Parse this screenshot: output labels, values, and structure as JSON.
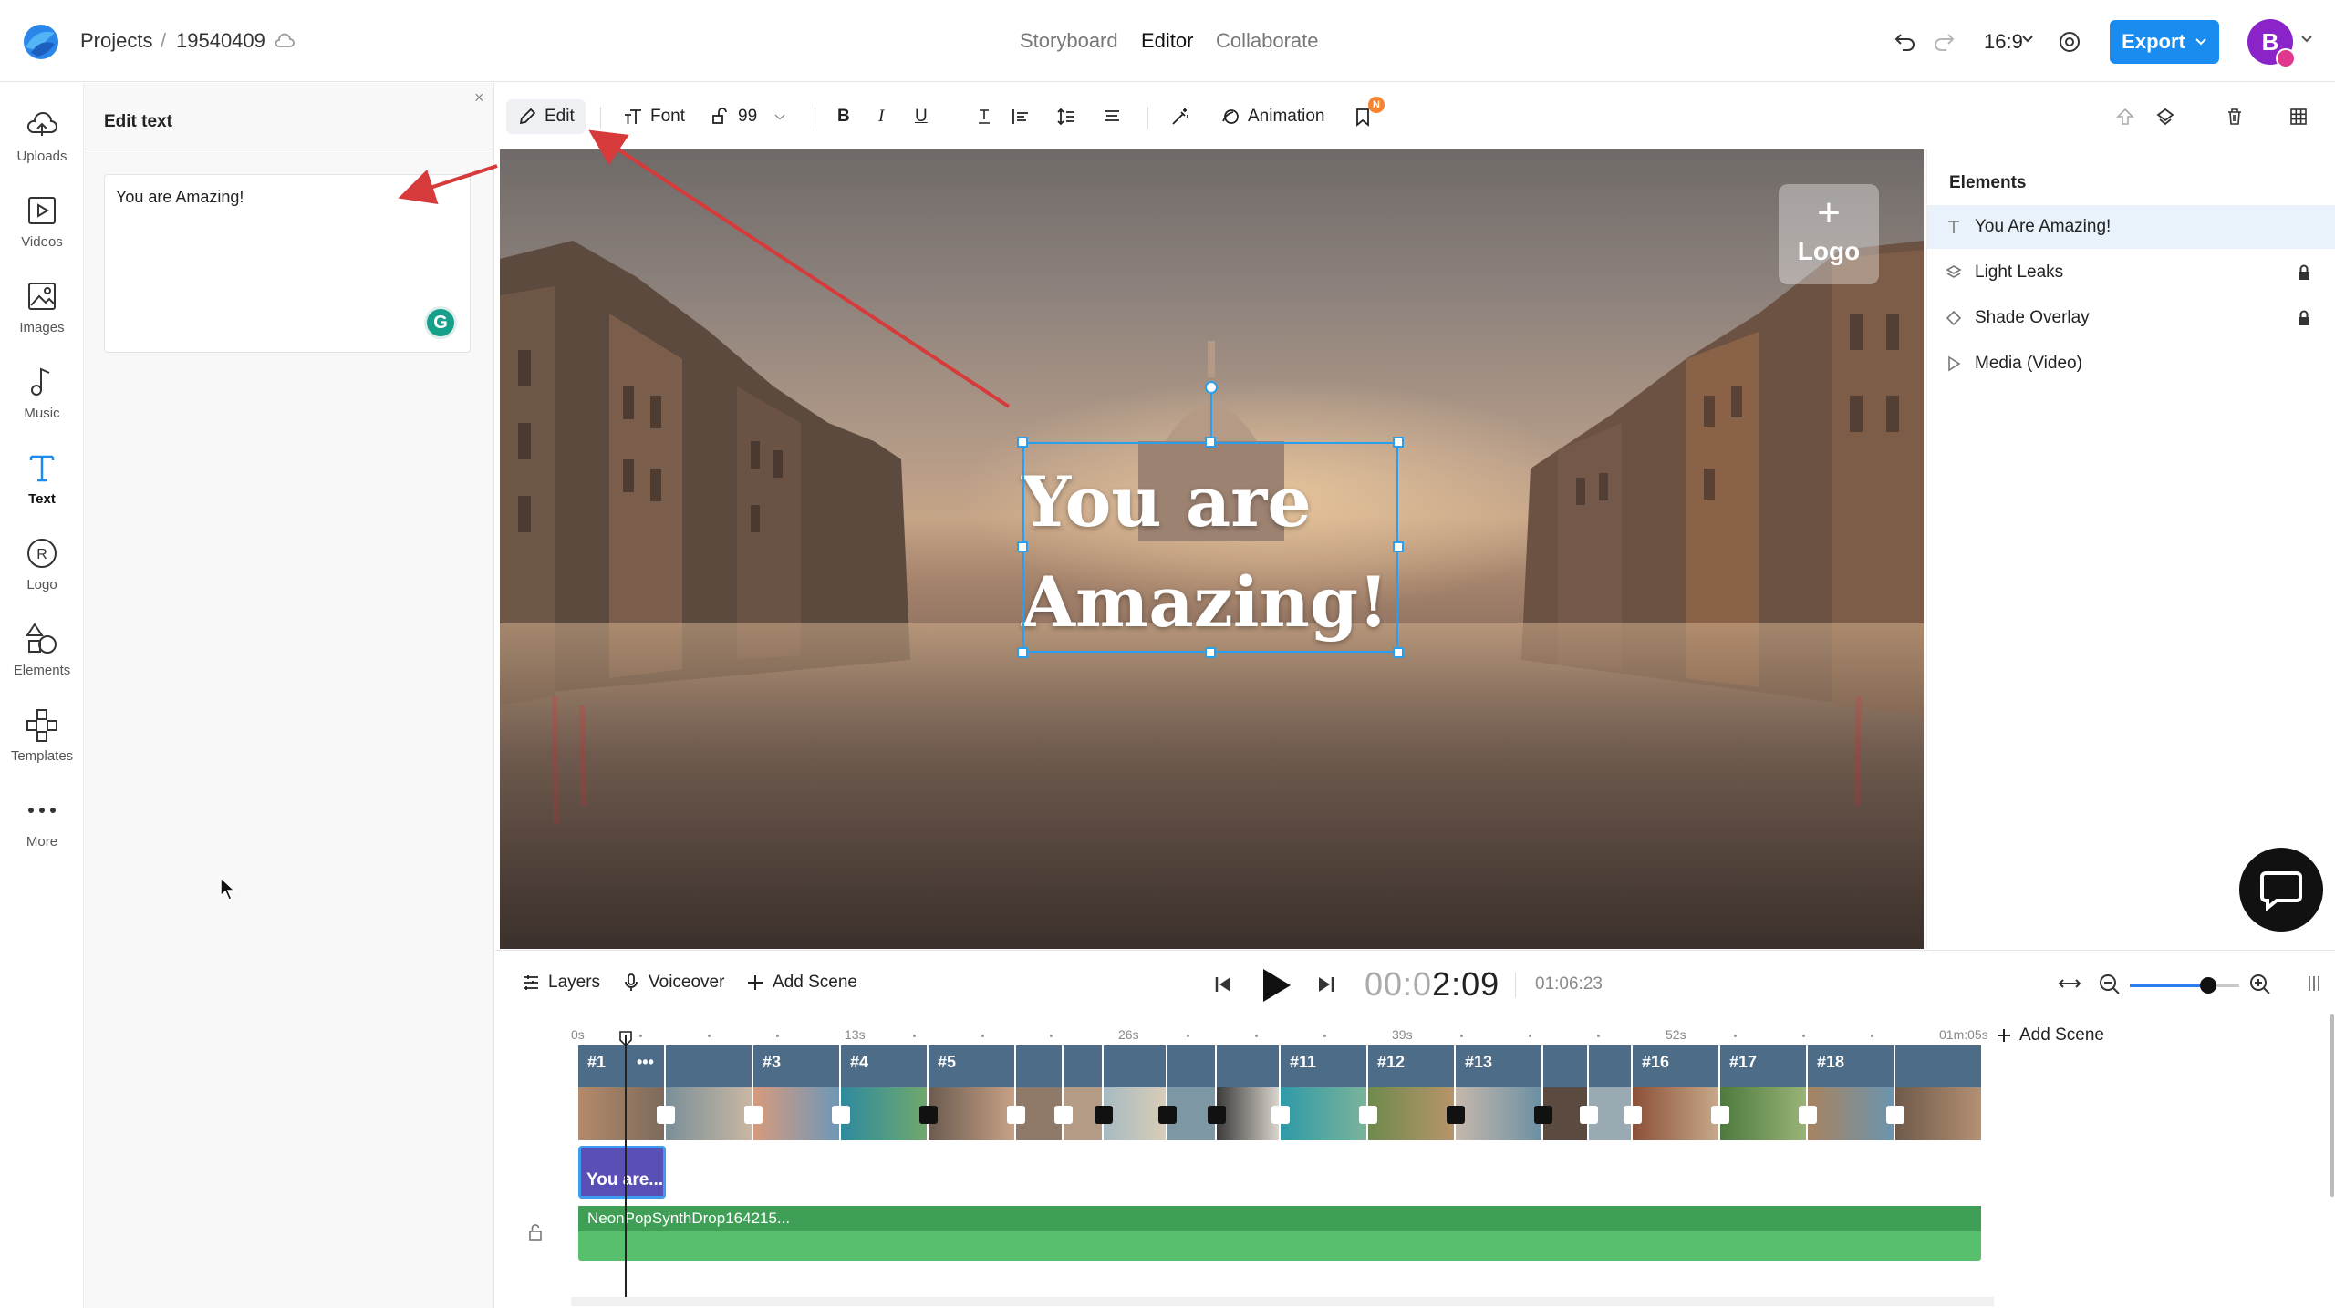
{
  "header": {
    "breadcrumb_projects": "Projects",
    "breadcrumb_sep": "/",
    "project_id": "19540409",
    "nav": {
      "storyboard": "Storyboard",
      "editor": "Editor",
      "collaborate": "Collaborate"
    },
    "aspect_ratio": "16:9",
    "export_label": "Export",
    "avatar_initial": "B",
    "accent_color": "#1a8cf0"
  },
  "rail": {
    "items": [
      {
        "label": "Uploads",
        "icon": "cloud-upload-icon"
      },
      {
        "label": "Videos",
        "icon": "video-icon"
      },
      {
        "label": "Images",
        "icon": "image-icon"
      },
      {
        "label": "Music",
        "icon": "music-icon"
      },
      {
        "label": "Text",
        "icon": "text-icon",
        "active": true
      },
      {
        "label": "Logo",
        "icon": "logo-icon"
      },
      {
        "label": "Elements",
        "icon": "elements-icon"
      },
      {
        "label": "Templates",
        "icon": "templates-icon"
      },
      {
        "label": "More",
        "icon": "more-icon"
      }
    ]
  },
  "edit_panel": {
    "title": "Edit text",
    "text_value": "You are Amazing!",
    "grammarly_letter": "G"
  },
  "toolbar": {
    "edit": "Edit",
    "font": "Font",
    "font_size": "99",
    "bold": "B",
    "italic": "I",
    "underline": "U",
    "animation": "Animation",
    "badge": "N"
  },
  "canvas": {
    "headline_line1": "You are",
    "headline_line2": "Amazing!",
    "logo_placeholder_plus": "+",
    "logo_placeholder_text": "Logo"
  },
  "elements_panel": {
    "title": "Elements",
    "items": [
      {
        "label": "You Are Amazing!",
        "icon": "text-icon",
        "locked": false,
        "selected": true
      },
      {
        "label": "Light Leaks",
        "icon": "layers-icon",
        "locked": true
      },
      {
        "label": "Shade Overlay",
        "icon": "diamond-icon",
        "locked": true
      },
      {
        "label": "Media (Video)",
        "icon": "play-icon",
        "locked": false
      }
    ]
  },
  "timeline": {
    "layers": "Layers",
    "voiceover": "Voiceover",
    "add_scene": "Add Scene",
    "time_current_dim": "00:0",
    "time_current_main": "2:09",
    "time_total": "01:06:23",
    "zoom_level": 0.72,
    "ruler_labels": [
      "0s",
      "13s",
      "26s",
      "39s",
      "52s",
      "01m:05s"
    ],
    "ruler_add_scene": "Add Scene",
    "scenes": [
      "#1",
      "",
      "#3",
      "#4",
      "#5",
      "",
      "",
      "",
      "",
      "",
      "#11",
      "#12",
      "#13",
      "",
      "",
      "#16",
      "#17",
      "#18",
      ""
    ],
    "scene_more": "•••",
    "text_clip": "You are...",
    "audio_clip": "NeonPopSynthDrop164215..."
  }
}
